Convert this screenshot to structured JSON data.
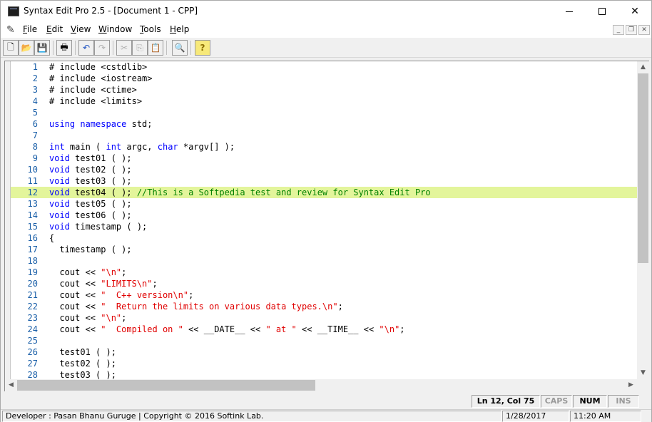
{
  "window": {
    "title": "Syntax Edit Pro 2.5 - [Document 1 - CPP]",
    "min_icon": "minimize-icon",
    "max_icon": "maximize-icon",
    "close_label": "✕"
  },
  "menu": {
    "items": [
      {
        "label": "File",
        "access": "F",
        "rest": "ile"
      },
      {
        "label": "Edit",
        "access": "E",
        "rest": "dit"
      },
      {
        "label": "View",
        "access": "V",
        "rest": "iew"
      },
      {
        "label": "Window",
        "access": "W",
        "rest": "indow"
      },
      {
        "label": "Tools",
        "access": "T",
        "rest": "ools"
      },
      {
        "label": "Help",
        "access": "H",
        "rest": "elp"
      }
    ],
    "mdi": {
      "minimize": "_",
      "restore": "❐",
      "close": "✕"
    }
  },
  "toolbar": {
    "buttons": [
      {
        "icon": "new-document-icon",
        "glyph": "🗋"
      },
      {
        "icon": "open-folder-icon",
        "glyph": "📂"
      },
      {
        "icon": "save-icon",
        "glyph": "💾"
      },
      {
        "icon": "print-icon",
        "glyph": "🖶"
      },
      {
        "icon": "undo-icon",
        "glyph": "↶"
      },
      {
        "icon": "redo-icon",
        "glyph": "↷"
      },
      {
        "icon": "cut-icon",
        "glyph": "✂"
      },
      {
        "icon": "copy-icon",
        "glyph": "⎘"
      },
      {
        "icon": "paste-icon",
        "glyph": "📋"
      },
      {
        "icon": "find-icon",
        "glyph": "🔍"
      },
      {
        "icon": "help-icon",
        "glyph": "?"
      }
    ]
  },
  "editor": {
    "current_line": 12,
    "lines": [
      {
        "n": "1",
        "tokens": [
          {
            "t": "# include <cstdlib>",
            "c": "pl"
          }
        ]
      },
      {
        "n": "2",
        "tokens": [
          {
            "t": "# include <iostream>",
            "c": "pl"
          }
        ]
      },
      {
        "n": "3",
        "tokens": [
          {
            "t": "# include <ctime>",
            "c": "pl"
          }
        ]
      },
      {
        "n": "4",
        "tokens": [
          {
            "t": "# include <limits>",
            "c": "pl"
          }
        ]
      },
      {
        "n": "5",
        "tokens": []
      },
      {
        "n": "6",
        "tokens": [
          {
            "t": "using namespace",
            "c": "kw"
          },
          {
            "t": " std;",
            "c": "pl"
          }
        ]
      },
      {
        "n": "7",
        "tokens": []
      },
      {
        "n": "8",
        "tokens": [
          {
            "t": "int",
            "c": "kw"
          },
          {
            "t": " main ( ",
            "c": "pl"
          },
          {
            "t": "int",
            "c": "kw"
          },
          {
            "t": " argc, ",
            "c": "pl"
          },
          {
            "t": "char",
            "c": "kw"
          },
          {
            "t": " *argv[] );",
            "c": "pl"
          }
        ]
      },
      {
        "n": "9",
        "tokens": [
          {
            "t": "void",
            "c": "kw"
          },
          {
            "t": " test01 ( );",
            "c": "pl"
          }
        ]
      },
      {
        "n": "10",
        "tokens": [
          {
            "t": "void",
            "c": "kw"
          },
          {
            "t": " test02 ( );",
            "c": "pl"
          }
        ]
      },
      {
        "n": "11",
        "tokens": [
          {
            "t": "void",
            "c": "kw"
          },
          {
            "t": " test03 ( );",
            "c": "pl"
          }
        ]
      },
      {
        "n": "12",
        "tokens": [
          {
            "t": "void",
            "c": "kw"
          },
          {
            "t": " test04 ( ); ",
            "c": "pl"
          },
          {
            "t": "//This is a Softpedia test and review for Syntax Edit Pro",
            "c": "cm"
          }
        ]
      },
      {
        "n": "13",
        "tokens": [
          {
            "t": "void",
            "c": "kw"
          },
          {
            "t": " test05 ( );",
            "c": "pl"
          }
        ]
      },
      {
        "n": "14",
        "tokens": [
          {
            "t": "void",
            "c": "kw"
          },
          {
            "t": " test06 ( );",
            "c": "pl"
          }
        ]
      },
      {
        "n": "15",
        "tokens": [
          {
            "t": "void",
            "c": "kw"
          },
          {
            "t": " timestamp ( );",
            "c": "pl"
          }
        ]
      },
      {
        "n": "16",
        "tokens": [
          {
            "t": "{",
            "c": "pl"
          }
        ]
      },
      {
        "n": "17",
        "tokens": [
          {
            "t": "  timestamp ( );",
            "c": "pl"
          }
        ]
      },
      {
        "n": "18",
        "tokens": []
      },
      {
        "n": "19",
        "tokens": [
          {
            "t": "  cout << ",
            "c": "pl"
          },
          {
            "t": "\"\\n\"",
            "c": "str"
          },
          {
            "t": ";",
            "c": "pl"
          }
        ]
      },
      {
        "n": "20",
        "tokens": [
          {
            "t": "  cout << ",
            "c": "pl"
          },
          {
            "t": "\"LIMITS\\n\"",
            "c": "str"
          },
          {
            "t": ";",
            "c": "pl"
          }
        ]
      },
      {
        "n": "21",
        "tokens": [
          {
            "t": "  cout << ",
            "c": "pl"
          },
          {
            "t": "\"  C++ version\\n\"",
            "c": "str"
          },
          {
            "t": ";",
            "c": "pl"
          }
        ]
      },
      {
        "n": "22",
        "tokens": [
          {
            "t": "  cout << ",
            "c": "pl"
          },
          {
            "t": "\"  Return the limits on various data types.\\n\"",
            "c": "str"
          },
          {
            "t": ";",
            "c": "pl"
          }
        ]
      },
      {
        "n": "23",
        "tokens": [
          {
            "t": "  cout << ",
            "c": "pl"
          },
          {
            "t": "\"\\n\"",
            "c": "str"
          },
          {
            "t": ";",
            "c": "pl"
          }
        ]
      },
      {
        "n": "24",
        "tokens": [
          {
            "t": "  cout << ",
            "c": "pl"
          },
          {
            "t": "\"  Compiled on \"",
            "c": "str"
          },
          {
            "t": " << __DATE__ << ",
            "c": "pl"
          },
          {
            "t": "\" at \"",
            "c": "str"
          },
          {
            "t": " << __TIME__ << ",
            "c": "pl"
          },
          {
            "t": "\"\\n\"",
            "c": "str"
          },
          {
            "t": ";",
            "c": "pl"
          }
        ]
      },
      {
        "n": "25",
        "tokens": []
      },
      {
        "n": "26",
        "tokens": [
          {
            "t": "  test01 ( );",
            "c": "pl"
          }
        ]
      },
      {
        "n": "27",
        "tokens": [
          {
            "t": "  test02 ( );",
            "c": "pl"
          }
        ]
      },
      {
        "n": "28",
        "tokens": [
          {
            "t": "  test03 ( );",
            "c": "pl"
          }
        ]
      }
    ],
    "vscroll_up": "▲",
    "vscroll_down": "▼",
    "hscroll_left": "◀",
    "hscroll_right": "▶"
  },
  "indicators": {
    "position": "Ln 12, Col 75",
    "caps": "CAPS",
    "num": "NUM",
    "ins": "INS"
  },
  "status": {
    "credits": "Developer : Pasan Bhanu Guruge | Copyright © 2016 Softink Lab.",
    "date": "1/28/2017",
    "time": "11:20 AM"
  },
  "colors": {
    "keyword": "#0000ff",
    "string": "#e00000",
    "comment": "#008000",
    "line_number": "#1a5fa8",
    "current_line_bg": "#e3f59b"
  }
}
